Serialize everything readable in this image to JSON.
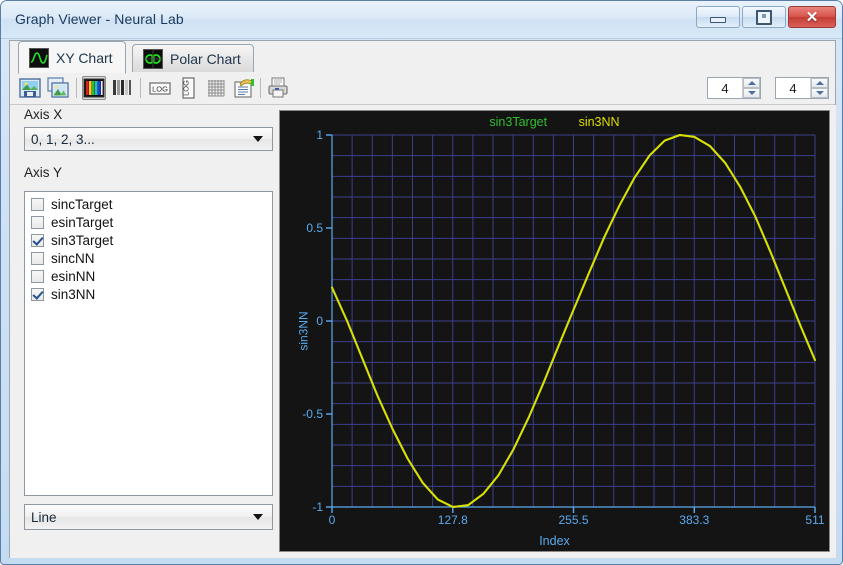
{
  "window": {
    "title": "Graph Viewer - Neural Lab",
    "buttons": {
      "minimize": "minimize",
      "maximize": "restore",
      "close": "✕"
    }
  },
  "tabs": [
    {
      "label": "XY Chart",
      "icon": "sine-wave-icon",
      "active": true
    },
    {
      "label": "Polar Chart",
      "icon": "polar-rings-icon",
      "active": false
    }
  ],
  "toolbar": {
    "icons": [
      {
        "name": "save-image-icon",
        "pressed": false
      },
      {
        "name": "copy-image-icon",
        "pressed": false
      },
      {
        "name": "color-bars-icon",
        "pressed": true
      },
      {
        "name": "gray-bars-icon",
        "pressed": false
      },
      {
        "name": "log-x-icon",
        "pressed": false
      },
      {
        "name": "log-y-icon",
        "pressed": false
      },
      {
        "name": "grid-icon",
        "pressed": false
      },
      {
        "name": "legend-icon",
        "pressed": false
      },
      {
        "name": "print-icon",
        "pressed": false
      }
    ],
    "spinner_left": {
      "value": "4"
    },
    "spinner_right": {
      "value": "4"
    }
  },
  "sidebar": {
    "axis_x_label": "Axis X",
    "axis_x_value": "0, 1, 2, 3...",
    "axis_y_label": "Axis Y",
    "series": [
      {
        "label": "sincTarget",
        "checked": false
      },
      {
        "label": "esinTarget",
        "checked": false
      },
      {
        "label": "sin3Target",
        "checked": true
      },
      {
        "label": "sincNN",
        "checked": false
      },
      {
        "label": "esinNN",
        "checked": false
      },
      {
        "label": "sin3NN",
        "checked": true
      }
    ],
    "plot_style_value": "Line"
  },
  "chart_data": {
    "type": "line",
    "title": "",
    "xlabel": "Index",
    "ylabel": "sin3NN",
    "xlim": [
      0,
      511
    ],
    "ylim": [
      -1,
      1
    ],
    "xticks": [
      "0",
      "127.8",
      "255.5",
      "383.3",
      "511"
    ],
    "xtick_values": [
      0,
      127.8,
      255.5,
      383.3,
      511
    ],
    "yticks": [
      "1",
      "0.5",
      "0",
      "-0.5",
      "-1"
    ],
    "ytick_values": [
      1,
      0.5,
      0,
      -0.5,
      -1
    ],
    "grid": true,
    "grid_color": "#3b3f8c",
    "background": "#141414",
    "axis_color": "#5aaaee",
    "legend_position": "top-center",
    "legend": [
      {
        "name": "sin3Target",
        "color": "#2fbf2f"
      },
      {
        "name": "sin3NN",
        "color": "#dede00"
      }
    ],
    "series": [
      {
        "name": "sin3Target",
        "color": "#2fbf2f",
        "points": [
          [
            0,
            0.18
          ],
          [
            16,
            0.0
          ],
          [
            32,
            -0.2
          ],
          [
            48,
            -0.4
          ],
          [
            64,
            -0.58
          ],
          [
            80,
            -0.74
          ],
          [
            96,
            -0.87
          ],
          [
            112,
            -0.96
          ],
          [
            128,
            -1.0
          ],
          [
            144,
            -0.99
          ],
          [
            160,
            -0.93
          ],
          [
            176,
            -0.83
          ],
          [
            192,
            -0.69
          ],
          [
            208,
            -0.52
          ],
          [
            224,
            -0.33
          ],
          [
            240,
            -0.13
          ],
          [
            255.5,
            0.06
          ],
          [
            272,
            0.26
          ],
          [
            288,
            0.45
          ],
          [
            304,
            0.62
          ],
          [
            320,
            0.77
          ],
          [
            336,
            0.89
          ],
          [
            352,
            0.97
          ],
          [
            368,
            1.0
          ],
          [
            383.3,
            0.99
          ],
          [
            400,
            0.94
          ],
          [
            416,
            0.85
          ],
          [
            432,
            0.72
          ],
          [
            448,
            0.56
          ],
          [
            464,
            0.37
          ],
          [
            480,
            0.17
          ],
          [
            496,
            -0.03
          ],
          [
            511,
            -0.21
          ]
        ]
      },
      {
        "name": "sin3NN",
        "color": "#dede00",
        "points": [
          [
            0,
            0.18
          ],
          [
            16,
            0.0
          ],
          [
            32,
            -0.2
          ],
          [
            48,
            -0.4
          ],
          [
            64,
            -0.58
          ],
          [
            80,
            -0.74
          ],
          [
            96,
            -0.87
          ],
          [
            112,
            -0.96
          ],
          [
            128,
            -1.0
          ],
          [
            144,
            -0.99
          ],
          [
            160,
            -0.93
          ],
          [
            176,
            -0.83
          ],
          [
            192,
            -0.69
          ],
          [
            208,
            -0.52
          ],
          [
            224,
            -0.33
          ],
          [
            240,
            -0.13
          ],
          [
            255.5,
            0.06
          ],
          [
            272,
            0.26
          ],
          [
            288,
            0.45
          ],
          [
            304,
            0.62
          ],
          [
            320,
            0.77
          ],
          [
            336,
            0.89
          ],
          [
            352,
            0.97
          ],
          [
            368,
            1.0
          ],
          [
            383.3,
            0.99
          ],
          [
            400,
            0.94
          ],
          [
            416,
            0.85
          ],
          [
            432,
            0.72
          ],
          [
            448,
            0.56
          ],
          [
            464,
            0.37
          ],
          [
            480,
            0.17
          ],
          [
            496,
            -0.03
          ],
          [
            511,
            -0.21
          ]
        ]
      }
    ]
  }
}
